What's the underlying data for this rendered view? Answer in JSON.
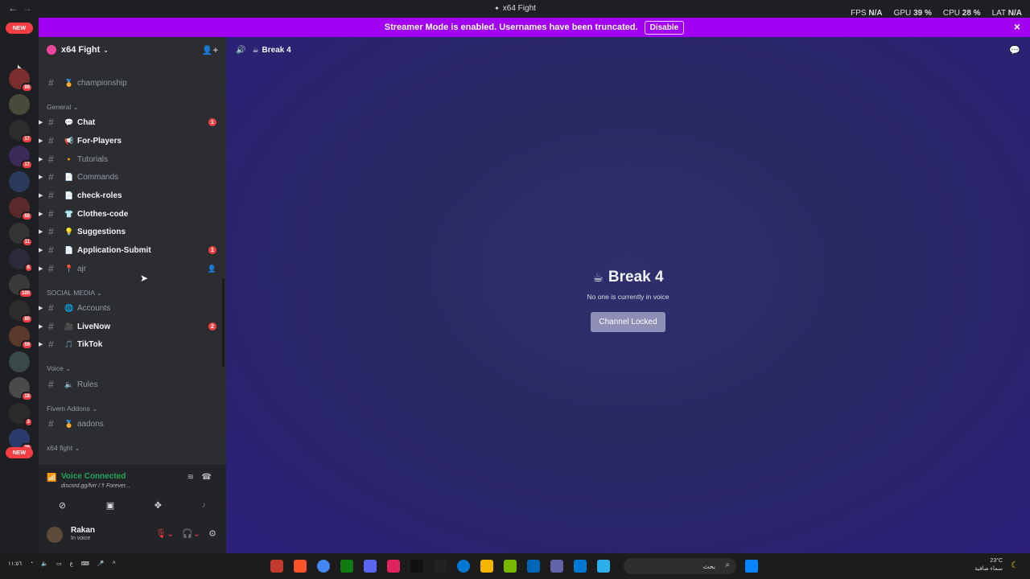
{
  "window": {
    "title": "x64 Fight",
    "perf": [
      {
        "label": "FPS",
        "value": "N/A"
      },
      {
        "label": "GPU",
        "value": "39 %"
      },
      {
        "label": "CPU",
        "value": "28 %"
      },
      {
        "label": "LAT",
        "value": "N/A"
      }
    ]
  },
  "banner": {
    "text": "Streamer Mode is enabled. Usernames have been truncated.",
    "disable_label": "Disable"
  },
  "guilds": {
    "new_label": "NEW",
    "badges": [
      "98",
      "17",
      "17",
      "68",
      "11",
      "6",
      "100",
      "80",
      "59",
      "18",
      "3",
      "29"
    ],
    "accent_color": "#f23f43"
  },
  "server": {
    "name": "x64 Fight"
  },
  "channels": {
    "top": [
      {
        "emoji": "🏅",
        "name": "championship",
        "bright": false
      }
    ],
    "categories": [
      {
        "label": "General"
      },
      {
        "label": "SOCIAL MEDIA"
      },
      {
        "label": "Voice"
      },
      {
        "label": "Fivem Addons"
      },
      {
        "label": "x64 fight"
      }
    ],
    "general": [
      {
        "emoji": "💬",
        "name": "Chat",
        "bright": true,
        "badge": "1"
      },
      {
        "emoji": "📢",
        "name": "For-Players",
        "bright": true
      },
      {
        "emoji": "🔸",
        "name": "Tutorials",
        "bright": false
      },
      {
        "emoji": "📄",
        "name": "Commands",
        "bright": false
      },
      {
        "emoji": "📄",
        "name": "check-roles",
        "bright": true
      },
      {
        "emoji": "👕",
        "name": "Clothes-code",
        "bright": true
      },
      {
        "emoji": "💡",
        "name": "Suggestions",
        "bright": true
      },
      {
        "emoji": "📄",
        "name": "Application-Submit",
        "bright": true,
        "badge": "1"
      },
      {
        "emoji": "📍",
        "name": "ajr",
        "bright": false
      }
    ],
    "social": [
      {
        "emoji": "🌐",
        "name": "Accounts",
        "bright": false
      },
      {
        "emoji": "🎥",
        "name": "LiveNow",
        "bright": true,
        "badge": "2"
      },
      {
        "emoji": "🎵",
        "name": "TikTok",
        "bright": true
      }
    ],
    "voice": [
      {
        "emoji": "🔈",
        "name": "Rules",
        "bright": false
      }
    ],
    "fivem": [
      {
        "emoji": "🏅",
        "name": "aadons",
        "bright": false
      }
    ]
  },
  "voice_status": {
    "title": "Voice Connected",
    "subtitle": "discord.gg/fvrr / ☨ Forever..."
  },
  "user": {
    "name": "Rakan",
    "status": "In voice"
  },
  "channel": {
    "header_name": "Break 4",
    "big_name": "Break 4",
    "empty_text": "No one is currently in voice",
    "locked_label": "Channel Locked"
  },
  "taskbar": {
    "search_placeholder": "بحث",
    "weather_temp": "23°C",
    "weather_desc": "سماء صافية",
    "left_text": [
      "١١:٥٦",
      "ع"
    ]
  }
}
